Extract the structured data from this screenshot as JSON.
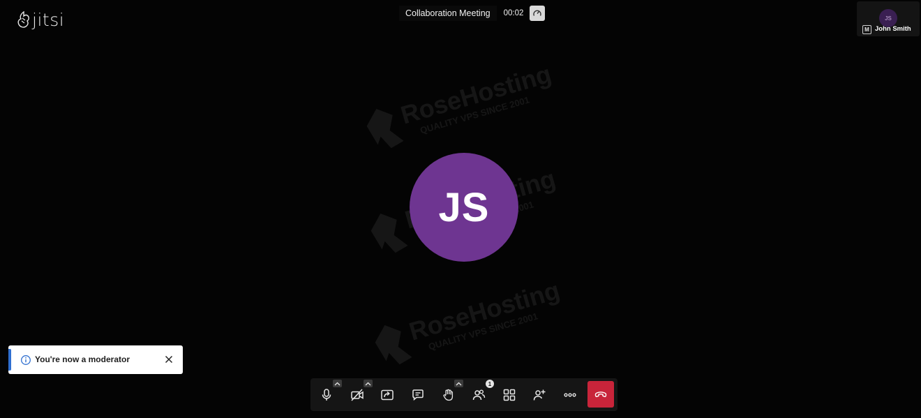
{
  "app": {
    "logo_text": "jitsi"
  },
  "header": {
    "meeting_title": "Collaboration Meeting",
    "timer": "00:02",
    "speed_icon": "gauge-icon"
  },
  "filmstrip": {
    "avatar_initials": "JS",
    "moderator_mark": "M",
    "participant_name": "John Smith"
  },
  "watermark": {
    "brand": "RoseHosting",
    "tagline": "QUALITY VPS SINCE 2001"
  },
  "main_video": {
    "avatar_initials": "JS",
    "avatar_color": "#6e3591"
  },
  "notification": {
    "text": "You're now a moderator",
    "icon": "info-icon",
    "close_icon": "close-icon",
    "accent_color": "#2f6fd0"
  },
  "toolbar": {
    "participant_count": "1",
    "buttons": [
      {
        "name": "microphone",
        "icon": "microphone-icon",
        "has_caret": true
      },
      {
        "name": "camera",
        "icon": "camera-off-icon",
        "has_caret": true
      },
      {
        "name": "share-screen",
        "icon": "share-screen-icon",
        "has_caret": false
      },
      {
        "name": "chat",
        "icon": "chat-icon",
        "has_caret": false
      },
      {
        "name": "raise-hand",
        "icon": "hand-icon",
        "has_caret": true
      },
      {
        "name": "participants",
        "icon": "participants-icon",
        "has_caret": false
      },
      {
        "name": "tile-view",
        "icon": "grid-icon",
        "has_caret": false
      },
      {
        "name": "invite",
        "icon": "add-person-icon",
        "has_caret": false
      },
      {
        "name": "more-actions",
        "icon": "more-icon",
        "has_caret": false
      },
      {
        "name": "leave",
        "icon": "hangup-icon",
        "has_caret": false
      }
    ],
    "hangup_color": "#c8243a"
  }
}
